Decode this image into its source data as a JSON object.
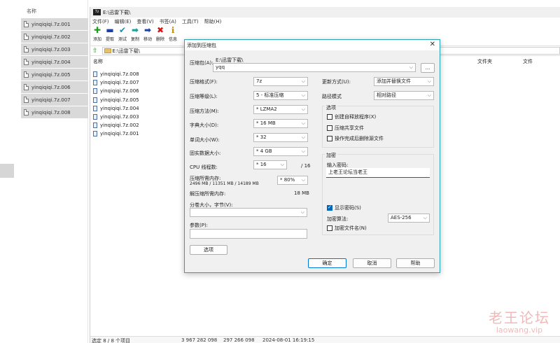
{
  "explorer": {
    "header": "名称",
    "items": [
      "yinqiqiqi.7z.001",
      "yinqiqiqi.7z.002",
      "yinqiqiqi.7z.003",
      "yinqiqiqi.7z.004",
      "yinqiqiqi.7z.005",
      "yinqiqiqi.7z.006",
      "yinqiqiqi.7z.007",
      "yinqiqiqi.7z.008"
    ]
  },
  "zip": {
    "title": "E:\\迅雷下载\\",
    "menu": [
      "文件(F)",
      "编辑(E)",
      "查看(V)",
      "书签(A)",
      "工具(T)",
      "帮助(H)"
    ],
    "toolbar": [
      {
        "label": "添加",
        "icon": "add-icon",
        "glyph": "✚",
        "color": "#1e9c1e"
      },
      {
        "label": "提取",
        "icon": "extract-icon",
        "glyph": "▬",
        "color": "#1c3fa8"
      },
      {
        "label": "测试",
        "icon": "test-icon",
        "glyph": "✔",
        "color": "#1c8fa8"
      },
      {
        "label": "复制",
        "icon": "copy-icon",
        "glyph": "➡",
        "color": "#18a0a0"
      },
      {
        "label": "移动",
        "icon": "move-icon",
        "glyph": "➡",
        "color": "#1c3fa8"
      },
      {
        "label": "删除",
        "icon": "delete-icon",
        "glyph": "✖",
        "color": "#d01818"
      },
      {
        "label": "信息",
        "icon": "info-icon",
        "glyph": "ℹ",
        "color": "#c09000"
      }
    ],
    "address": "E:\\迅雷下载\\",
    "columns": {
      "name": "名称",
      "folder": "文件夹",
      "files": "文件"
    },
    "files": [
      "yinqiqiqi.7z.008",
      "yinqiqiqi.7z.007",
      "yinqiqiqi.7z.006",
      "yinqiqiqi.7z.005",
      "yinqiqiqi.7z.004",
      "yinqiqiqi.7z.003",
      "yinqiqiqi.7z.002",
      "yinqiqiqi.7z.001"
    ],
    "status": {
      "selection": "选定 8 / 8 个项目",
      "size1": "3 967 282 098",
      "size2": "297 266 098",
      "date": "2024-08-01 16:19:15"
    }
  },
  "dialog": {
    "title": "添加到压缩包",
    "archive_label": "压缩包(A):",
    "archive_dir": "E:\\迅雷下载\\",
    "archive_name": "yqq",
    "browse_label": "...",
    "format_label": "压缩格式(F):",
    "format_value": "7z",
    "level_label": "压缩等级(L):",
    "level_value": "5 - 标准压缩",
    "method_label": "压缩方法(M):",
    "method_value": "* LZMA2",
    "dict_label": "字典大小(D):",
    "dict_value": "* 16 MB",
    "word_label": "单词大小(W):",
    "word_value": "* 32",
    "solid_label": "固实数据大小:",
    "solid_value": "* 4 GB",
    "cpu_label": "CPU 线程数:",
    "cpu_value": "* 16",
    "cpu_max": "/ 16",
    "mem_label": "压缩所需内存:",
    "mem_detail": "2496 MB / 11351 MB / 14189 MB",
    "mem_value": "* 80%",
    "decomp_label": "解压缩所需内存:",
    "decomp_value": "18 MB",
    "split_label": "分卷大小，字节(V):",
    "split_value": "",
    "params_label": "参数(P):",
    "params_value": "",
    "options_button": "选项",
    "update_label": "更新方式(U):",
    "update_value": "添加并替换文件",
    "path_label": "路径模式",
    "path_value": "相对路径",
    "options_group": "选项",
    "opt_sfx": "创建自释放程序(X)",
    "opt_shared": "压缩共享文件",
    "opt_delete": "操作完成后删除源文件",
    "enc_group": "加密",
    "enc_pw_label": "输入密码:",
    "enc_pw_value": "上老王论坛当老王",
    "show_pw": "显示密码(S)",
    "enc_method_label": "加密算法:",
    "enc_method_value": "AES-256",
    "enc_names": "加密文件名(N)",
    "ok": "确定",
    "cancel": "取消",
    "help": "帮助",
    "close_glyph": "✕"
  },
  "watermark": {
    "cn": "老王论坛",
    "en": "laowang.vip"
  }
}
